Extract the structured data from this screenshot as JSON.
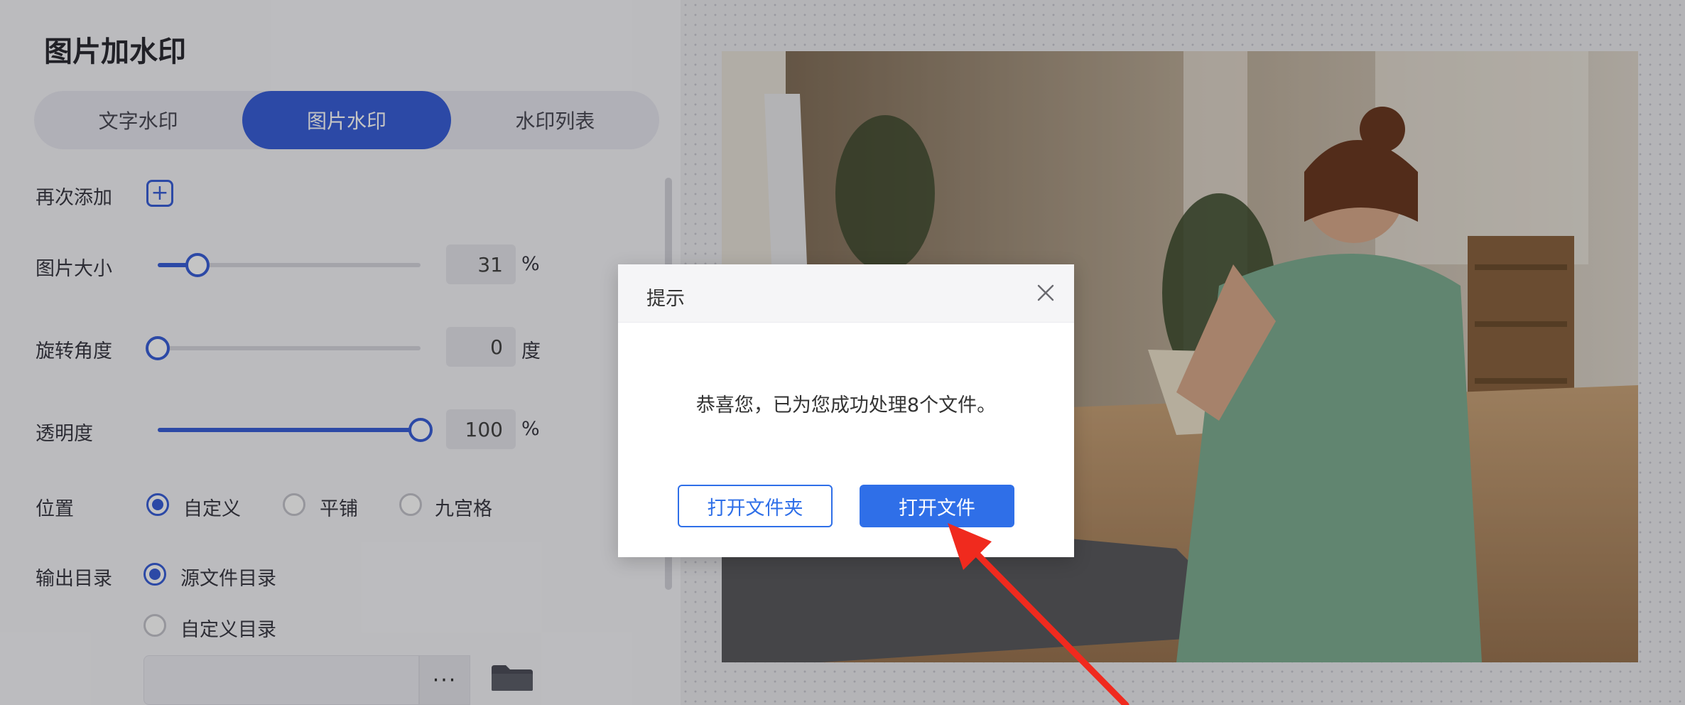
{
  "panel": {
    "title": "图片加水印",
    "tabs": [
      "文字水印",
      "图片水印",
      "水印列表"
    ],
    "active_tab": "图片水印"
  },
  "settings": {
    "add_again_label": "再次添加",
    "size_label": "图片大小",
    "size_value": "31",
    "size_unit": "%",
    "size_fraction": 0.15,
    "rotation_label": "旋转角度",
    "rotation_value": "0",
    "rotation_unit": "度",
    "rotation_fraction": 0.0,
    "opacity_label": "透明度",
    "opacity_value": "100",
    "opacity_unit": "%",
    "opacity_fraction": 1.0,
    "position_label": "位置",
    "position_options": [
      "自定义",
      "平铺",
      "九宫格"
    ],
    "position_selected": "自定义",
    "output_label": "输出目录",
    "output_options": [
      "源文件目录",
      "自定义目录"
    ],
    "output_selected": "源文件目录",
    "browse_label": "···"
  },
  "dialog": {
    "title": "提示",
    "message": "恭喜您，已为您成功处理8个文件。",
    "open_folder": "打开文件夹",
    "open_file": "打开文件"
  },
  "colors": {
    "accent": "#3a5fd8",
    "button_primary": "#2f6fe8",
    "arrow": "#f02a1e"
  },
  "icons": {
    "plus": "plus-icon",
    "close": "close-icon",
    "folder": "folder-icon",
    "arrow": "red-arrow-annotation"
  }
}
